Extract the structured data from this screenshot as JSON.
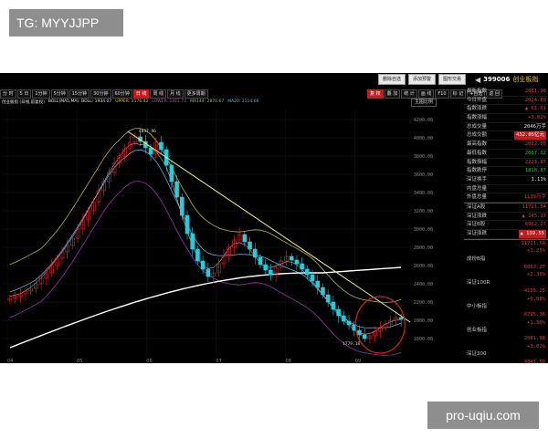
{
  "watermarks": {
    "top_left": "TG: MYYJJPP",
    "bottom_right": "pro-uqiu.com"
  },
  "toolbar": {
    "top_buttons": [
      "删除自选",
      "添加预警",
      "图形交易"
    ],
    "code": "399006",
    "name": "创业板指",
    "periods": [
      "分 时",
      "5 日",
      "1分钟",
      "5分钟",
      "15分钟",
      "30分钟",
      "60分钟",
      "日 线",
      "周 线",
      "月 线",
      "更多周期"
    ],
    "active_period": "日 线",
    "right_tools": [
      "复 权",
      "叠 加",
      "统 计",
      "画 线",
      "F10",
      "标 记",
      "+自选",
      "返 回"
    ],
    "active_right_tool": "复 权"
  },
  "indicator_line": {
    "name": "创业板指 (日线,前复权)",
    "boll": "BOLL(MA5,MA): BOLL: 1934.07",
    "upper": "UPPER: 2176.42",
    "lower": "LOWER: 1811.72",
    "ma144": "MA144: 2870.67",
    "ma20": "MA20: 2114.66",
    "ratio_button": "主图比例"
  },
  "chart_data": {
    "type": "candlestick",
    "y_ticks": [
      "4200.00",
      "4000.00",
      "3800.00",
      "3600.00",
      "3400.00",
      "3200.00",
      "3000.00",
      "2800.00",
      "2600.00",
      "2400.00",
      "2200.00",
      "2000.00",
      "1800.00"
    ],
    "ylim": [
      1600,
      4300
    ],
    "x_ticks": [
      "04",
      "05",
      "06",
      "07",
      "08",
      "09"
    ],
    "annotations": {
      "high": "4037.96",
      "low": "1779.18"
    },
    "series_close": [
      2240,
      2260,
      2290,
      2320,
      2350,
      2400,
      2460,
      2520,
      2600,
      2680,
      2750,
      2820,
      2900,
      3000,
      3100,
      3200,
      3300,
      3420,
      3520,
      3620,
      3720,
      3800,
      3880,
      3950,
      4010,
      3960,
      3890,
      3820,
      3950,
      3870,
      3700,
      3520,
      3350,
      3150,
      2950,
      2780,
      2650,
      2560,
      2480,
      2520,
      2620,
      2710,
      2800,
      2880,
      2940,
      2860,
      2780,
      2690,
      2610,
      2550,
      2500,
      2580,
      2650,
      2700,
      2660,
      2620,
      2560,
      2500,
      2430,
      2360,
      2280,
      2200,
      2120,
      2050,
      1990,
      1950,
      1890,
      1840,
      1800,
      1830,
      1880,
      1920,
      1960,
      2000,
      2030,
      2010
    ],
    "colors": {
      "up": "#e8262a",
      "down": "#1ecfe0",
      "trendline": "#f5f07a",
      "ma144": "#ffffff",
      "circle": "#d62020"
    }
  },
  "panel": {
    "rows_a": [
      {
        "label": "最新指数",
        "value": "2081.98",
        "cls": ""
      },
      {
        "label": "今日开盘",
        "value": "2024.89",
        "cls": ""
      },
      {
        "label": "指数涨跌",
        "value": "▲ 61.01",
        "cls": ""
      },
      {
        "label": "指数涨幅",
        "value": "+3.02%",
        "cls": ""
      },
      {
        "label": "总成交量",
        "value": "2046万手",
        "cls": "w"
      },
      {
        "label": "总成交额",
        "value": "432.05亿元",
        "cls": "pill"
      },
      {
        "label": "最高指数",
        "value": "2092.05",
        "cls": ""
      },
      {
        "label": "最低指数",
        "value": "2007.32",
        "cls": "g"
      },
      {
        "label": "指数振幅",
        "value": "2223.87",
        "cls": ""
      },
      {
        "label": "指数跌停",
        "value": "1818.87",
        "cls": "g"
      },
      {
        "label": "深证换手",
        "value": "1.11%",
        "cls": "w"
      },
      {
        "label": "内盘总量",
        "value": "",
        "cls": "w"
      },
      {
        "label": "外盘总量",
        "value": "1139万手",
        "cls": ""
      }
    ],
    "rows_b": [
      {
        "label": "深证A股",
        "value": "11721.54",
        "cls": ""
      },
      {
        "label": "深证涨跌",
        "value": "▲ 145.17",
        "cls": ""
      },
      {
        "label": "深证B股",
        "value": "6062.27",
        "cls": ""
      },
      {
        "label": "深证涨跌",
        "value": "▲ 139.55",
        "cls": "pill"
      }
    ],
    "list_c": [
      {
        "text": "11721.54",
        "type": "val"
      },
      {
        "text": "+1.25%",
        "type": "val"
      },
      {
        "text": "成份B指",
        "type": "lbl"
      },
      {
        "text": "6062.27",
        "type": "val"
      },
      {
        "text": "+2.36%",
        "type": "val"
      },
      {
        "text": "深证100R",
        "type": "lbl"
      },
      {
        "text": "4105.25",
        "type": "val"
      },
      {
        "text": "+0.88%",
        "type": "val"
      },
      {
        "text": "中小板指",
        "type": "lbl"
      },
      {
        "text": "6795.36",
        "type": "val"
      },
      {
        "text": "+1.30%",
        "type": "val"
      },
      {
        "text": "创业板指",
        "type": "lbl"
      },
      {
        "text": "2081.98",
        "type": "val"
      },
      {
        "text": "+3.02%",
        "type": "val"
      },
      {
        "text": "深证300",
        "type": "lbl"
      },
      {
        "text": "4841.50",
        "type": "val"
      },
      {
        "text": "+1.12%",
        "type": "val"
      }
    ]
  }
}
